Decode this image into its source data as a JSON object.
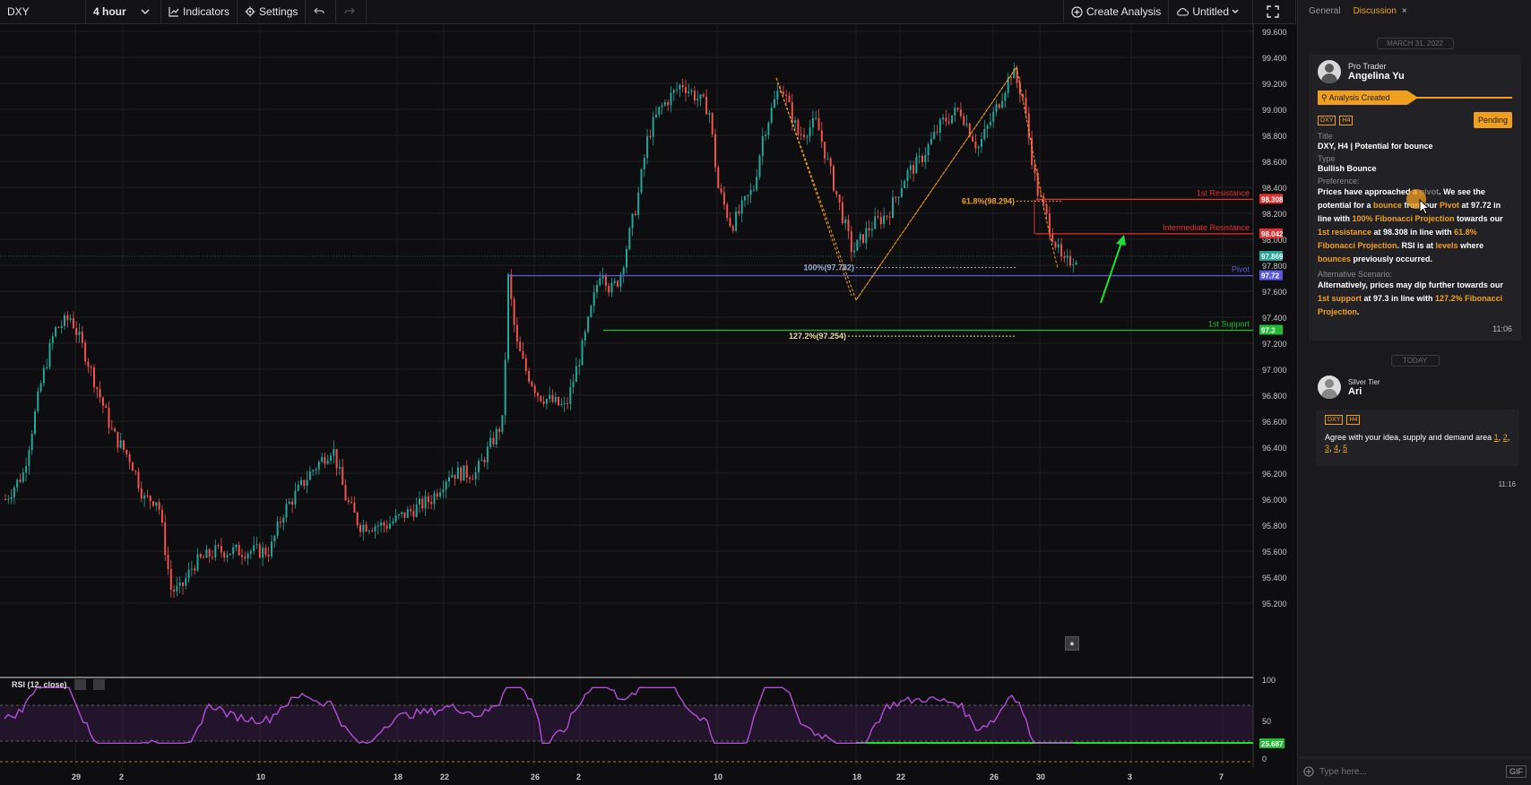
{
  "toolbar": {
    "symbol": "DXY",
    "interval": "4 hour",
    "indicators_label": "Indicators",
    "settings_label": "Settings",
    "create_label": "Create Analysis",
    "layout_label": "Untitled"
  },
  "price_axis": {
    "labels": [
      "99.600",
      "99.400",
      "99.200",
      "99.000",
      "98.800",
      "98.600",
      "98.400",
      "98.200",
      "98.000",
      "97.800",
      "97.600",
      "97.400",
      "97.200",
      "97.000",
      "96.800",
      "96.600",
      "96.400",
      "96.200",
      "96.000",
      "95.800",
      "95.600",
      "95.400",
      "95.200"
    ],
    "badges": [
      {
        "text": "98.308",
        "color": "#e03030"
      },
      {
        "text": "98.042",
        "color": "#e03030"
      },
      {
        "text": "97.869",
        "color": "#26a69a"
      },
      {
        "text": "97.72",
        "color": "#5a5ae0"
      },
      {
        "text": "97.3",
        "color": "#22bb33"
      }
    ]
  },
  "time_axis": [
    "29",
    "2",
    "10",
    "18",
    "22",
    "26",
    "2",
    "10",
    "18",
    "22",
    "26",
    "30",
    "3",
    "7"
  ],
  "levels": {
    "resistance1": "1st Resistance",
    "intermediate": "Intermediate Resistance",
    "pivot": "Pivot",
    "support1": "1st Support"
  },
  "fib": {
    "f618": "61.8%(98.294)",
    "f100": "100%(97.782)",
    "f1272": "127.2%(97.254)"
  },
  "rsi": {
    "title": "RSI (12, close)",
    "axis": [
      "100",
      "50",
      "0"
    ],
    "value": "25.687",
    "line_color": "#b34fd8"
  },
  "colors": {
    "up": "#26a69a",
    "down": "#ef5350",
    "accent": "#f0a020",
    "resistance": "#e03030",
    "pivot": "#5a5ae0",
    "support": "#22bb33"
  },
  "panel": {
    "tabs": {
      "general": "General",
      "discussion": "Discussion",
      "close": "×"
    },
    "date": "MARCH 31, 2022",
    "post": {
      "tier": "Pro Trader",
      "name": "Angelina Yu",
      "status": "Analysis Created",
      "tags": [
        "DXY",
        "H4"
      ],
      "pending": "Pending",
      "title_label": "Title",
      "title": "DXY, H4 | Potential for bounce",
      "type_label": "Type",
      "type": "Bullish Bounce",
      "pref_label": "Preference:",
      "alt_label": "Alternative Scenario:",
      "time": "11:06"
    },
    "today": "TODAY",
    "comment": {
      "tier": "Silver Tier",
      "name": "Ari",
      "tags": [
        "DXY",
        "H4"
      ],
      "text": "Agree with your idea, supply and demand area",
      "links": [
        "1",
        "2",
        "3",
        "4",
        "5"
      ],
      "time": "11:16"
    },
    "composer_placeholder": "Type here...",
    "gif": "GIF"
  }
}
